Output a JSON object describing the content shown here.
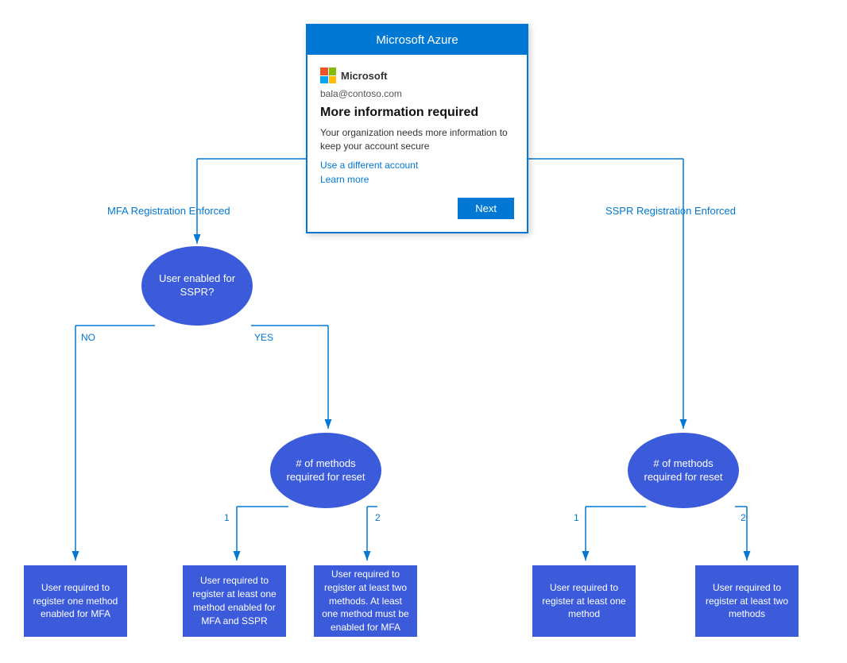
{
  "dialog": {
    "header": "Microsoft Azure",
    "logo_text": "Microsoft",
    "email": "bala@contoso.com",
    "title": "More information required",
    "description": "Your organization needs more information to keep your account secure",
    "link1": "Use a different account",
    "link2": "Learn more",
    "next_button": "Next"
  },
  "labels": {
    "mfa_enforced": "MFA Registration Enforced",
    "sspr_enforced": "SSPR Registration Enforced"
  },
  "nodes": {
    "sspr_question": "User enabled for\nSSPR?",
    "methods_mfa": "# of methods\nrequired for reset",
    "methods_sspr": "# of methods\nrequired for reset"
  },
  "branch_labels": {
    "no": "NO",
    "yes": "YES",
    "one_left": "1",
    "two_left": "2",
    "one_right": "1",
    "two_right": "2"
  },
  "results": {
    "mfa_only": "User required to register one method enabled for MFA",
    "mfa_sspr_one": "User required to register at least one method enabled for MFA and SSPR",
    "mfa_sspr_two": "User required to register at least two methods. At least one method must be enabled for MFA",
    "sspr_one": "User required to register at least one method",
    "sspr_two": "User required to register at least two methods"
  }
}
